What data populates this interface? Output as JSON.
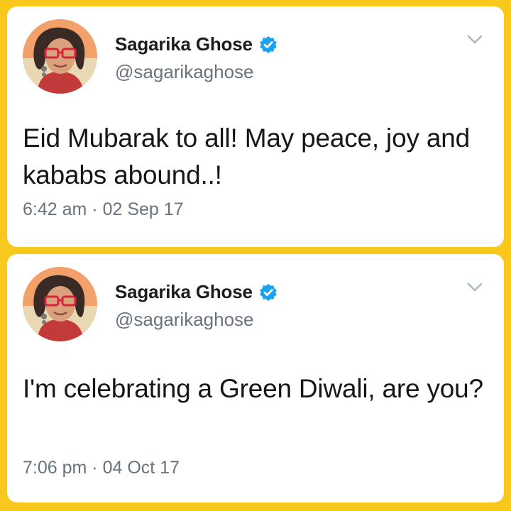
{
  "tweets": [
    {
      "author": {
        "name": "Sagarika Ghose",
        "handle": "@sagarikaghose",
        "verified": true
      },
      "text": "Eid Mubarak to all! May peace, joy and kababs abound..!",
      "time": "6:42 am",
      "separator": "·",
      "date": "02 Sep 17"
    },
    {
      "author": {
        "name": "Sagarika Ghose",
        "handle": "@sagarikaghose",
        "verified": true
      },
      "text": "I'm celebrating a Green Diwali, are you?",
      "time": "7:06 pm",
      "separator": "·",
      "date": "04 Oct 17"
    }
  ],
  "icons": {
    "verified": "verified-badge-icon",
    "menu": "chevron-down-icon"
  },
  "colors": {
    "frame": "#f8c81d",
    "card": "#ffffff",
    "verified": "#1da1f2",
    "secondary_text": "#68737d",
    "primary_text": "#14171a"
  }
}
